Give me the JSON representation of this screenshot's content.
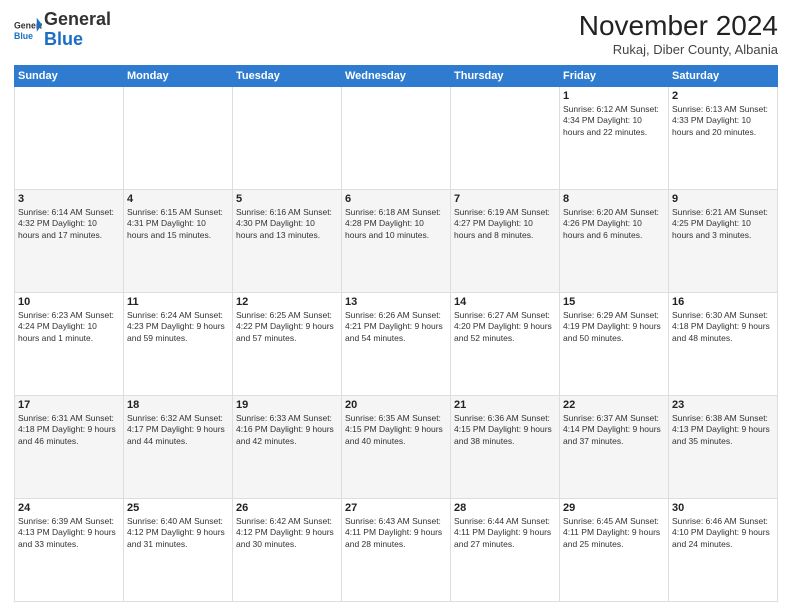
{
  "logo": {
    "general": "General",
    "blue": "Blue"
  },
  "header": {
    "month_title": "November 2024",
    "location": "Rukaj, Diber County, Albania"
  },
  "days_of_week": [
    "Sunday",
    "Monday",
    "Tuesday",
    "Wednesday",
    "Thursday",
    "Friday",
    "Saturday"
  ],
  "weeks": [
    [
      {
        "day": "",
        "info": ""
      },
      {
        "day": "",
        "info": ""
      },
      {
        "day": "",
        "info": ""
      },
      {
        "day": "",
        "info": ""
      },
      {
        "day": "",
        "info": ""
      },
      {
        "day": "1",
        "info": "Sunrise: 6:12 AM\nSunset: 4:34 PM\nDaylight: 10 hours and 22 minutes."
      },
      {
        "day": "2",
        "info": "Sunrise: 6:13 AM\nSunset: 4:33 PM\nDaylight: 10 hours and 20 minutes."
      }
    ],
    [
      {
        "day": "3",
        "info": "Sunrise: 6:14 AM\nSunset: 4:32 PM\nDaylight: 10 hours and 17 minutes."
      },
      {
        "day": "4",
        "info": "Sunrise: 6:15 AM\nSunset: 4:31 PM\nDaylight: 10 hours and 15 minutes."
      },
      {
        "day": "5",
        "info": "Sunrise: 6:16 AM\nSunset: 4:30 PM\nDaylight: 10 hours and 13 minutes."
      },
      {
        "day": "6",
        "info": "Sunrise: 6:18 AM\nSunset: 4:28 PM\nDaylight: 10 hours and 10 minutes."
      },
      {
        "day": "7",
        "info": "Sunrise: 6:19 AM\nSunset: 4:27 PM\nDaylight: 10 hours and 8 minutes."
      },
      {
        "day": "8",
        "info": "Sunrise: 6:20 AM\nSunset: 4:26 PM\nDaylight: 10 hours and 6 minutes."
      },
      {
        "day": "9",
        "info": "Sunrise: 6:21 AM\nSunset: 4:25 PM\nDaylight: 10 hours and 3 minutes."
      }
    ],
    [
      {
        "day": "10",
        "info": "Sunrise: 6:23 AM\nSunset: 4:24 PM\nDaylight: 10 hours and 1 minute."
      },
      {
        "day": "11",
        "info": "Sunrise: 6:24 AM\nSunset: 4:23 PM\nDaylight: 9 hours and 59 minutes."
      },
      {
        "day": "12",
        "info": "Sunrise: 6:25 AM\nSunset: 4:22 PM\nDaylight: 9 hours and 57 minutes."
      },
      {
        "day": "13",
        "info": "Sunrise: 6:26 AM\nSunset: 4:21 PM\nDaylight: 9 hours and 54 minutes."
      },
      {
        "day": "14",
        "info": "Sunrise: 6:27 AM\nSunset: 4:20 PM\nDaylight: 9 hours and 52 minutes."
      },
      {
        "day": "15",
        "info": "Sunrise: 6:29 AM\nSunset: 4:19 PM\nDaylight: 9 hours and 50 minutes."
      },
      {
        "day": "16",
        "info": "Sunrise: 6:30 AM\nSunset: 4:18 PM\nDaylight: 9 hours and 48 minutes."
      }
    ],
    [
      {
        "day": "17",
        "info": "Sunrise: 6:31 AM\nSunset: 4:18 PM\nDaylight: 9 hours and 46 minutes."
      },
      {
        "day": "18",
        "info": "Sunrise: 6:32 AM\nSunset: 4:17 PM\nDaylight: 9 hours and 44 minutes."
      },
      {
        "day": "19",
        "info": "Sunrise: 6:33 AM\nSunset: 4:16 PM\nDaylight: 9 hours and 42 minutes."
      },
      {
        "day": "20",
        "info": "Sunrise: 6:35 AM\nSunset: 4:15 PM\nDaylight: 9 hours and 40 minutes."
      },
      {
        "day": "21",
        "info": "Sunrise: 6:36 AM\nSunset: 4:15 PM\nDaylight: 9 hours and 38 minutes."
      },
      {
        "day": "22",
        "info": "Sunrise: 6:37 AM\nSunset: 4:14 PM\nDaylight: 9 hours and 37 minutes."
      },
      {
        "day": "23",
        "info": "Sunrise: 6:38 AM\nSunset: 4:13 PM\nDaylight: 9 hours and 35 minutes."
      }
    ],
    [
      {
        "day": "24",
        "info": "Sunrise: 6:39 AM\nSunset: 4:13 PM\nDaylight: 9 hours and 33 minutes."
      },
      {
        "day": "25",
        "info": "Sunrise: 6:40 AM\nSunset: 4:12 PM\nDaylight: 9 hours and 31 minutes."
      },
      {
        "day": "26",
        "info": "Sunrise: 6:42 AM\nSunset: 4:12 PM\nDaylight: 9 hours and 30 minutes."
      },
      {
        "day": "27",
        "info": "Sunrise: 6:43 AM\nSunset: 4:11 PM\nDaylight: 9 hours and 28 minutes."
      },
      {
        "day": "28",
        "info": "Sunrise: 6:44 AM\nSunset: 4:11 PM\nDaylight: 9 hours and 27 minutes."
      },
      {
        "day": "29",
        "info": "Sunrise: 6:45 AM\nSunset: 4:11 PM\nDaylight: 9 hours and 25 minutes."
      },
      {
        "day": "30",
        "info": "Sunrise: 6:46 AM\nSunset: 4:10 PM\nDaylight: 9 hours and 24 minutes."
      }
    ]
  ]
}
